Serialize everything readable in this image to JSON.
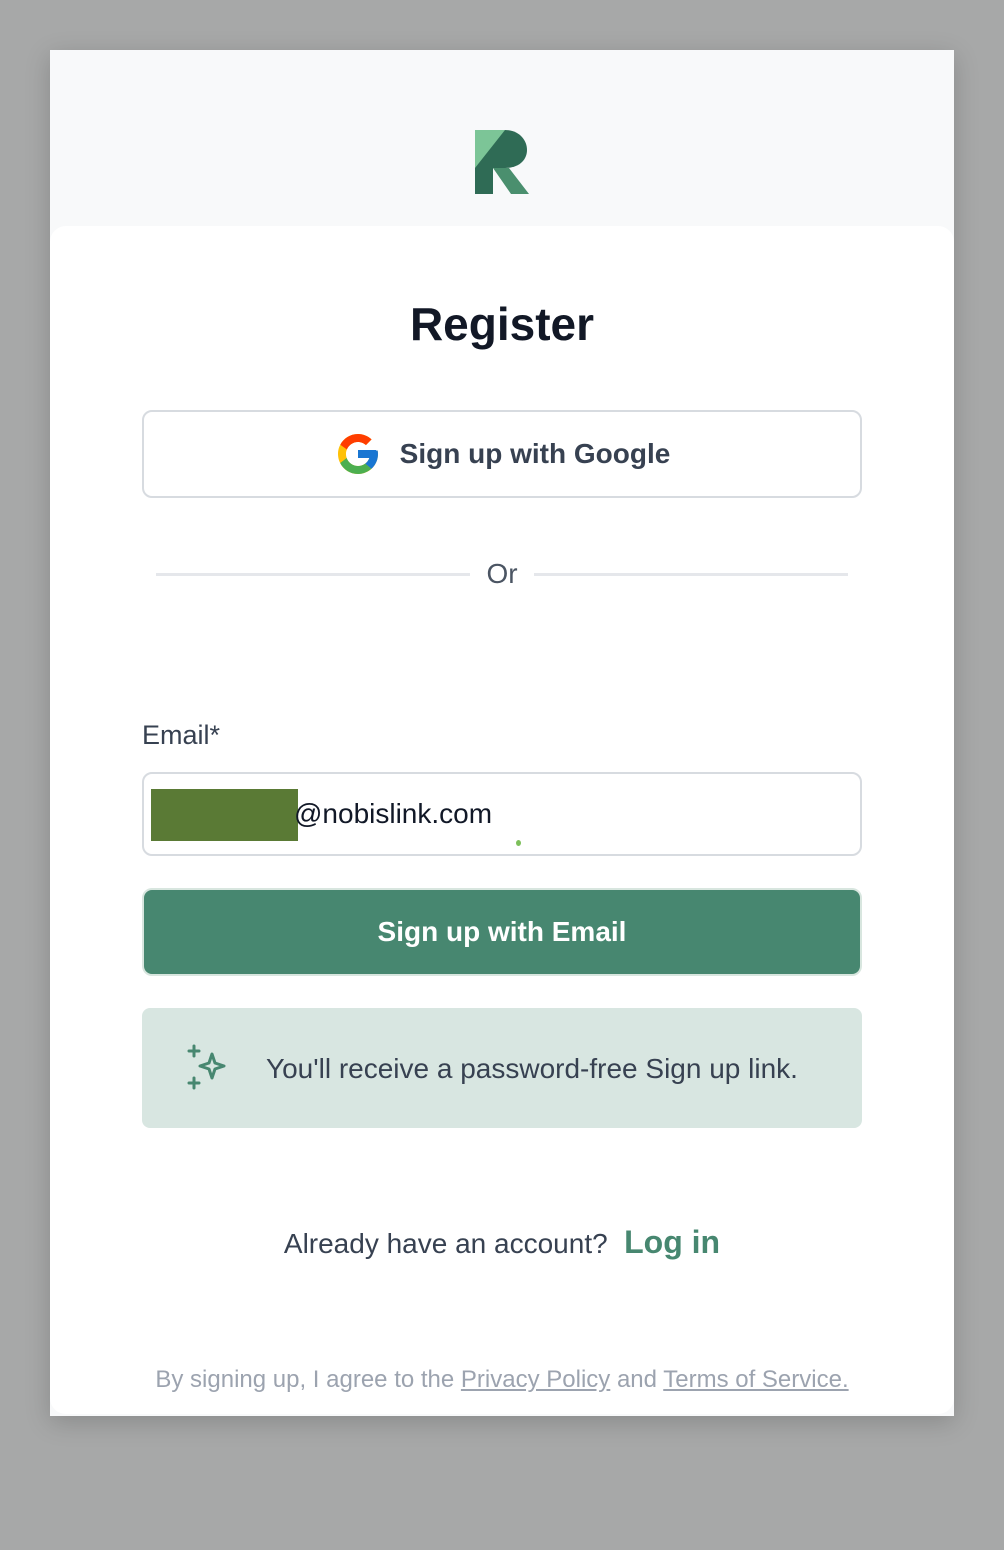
{
  "brand": {
    "logo_icon": "r-logo-icon",
    "colors": {
      "primary": "#478770",
      "logo_light": "#6fb48a",
      "logo_dark": "#2f6b55",
      "info_bg": "#d8e6e1"
    }
  },
  "form": {
    "title": "Register",
    "google_button_label": "Sign up with Google",
    "google_icon": "google-icon",
    "divider_text": "Or",
    "email_label": "Email*",
    "email_value": "@nobislink.com",
    "email_button_label": "Sign up with Email",
    "info_icon": "sparkle-icon",
    "info_text": "You'll receive a password-free Sign up link."
  },
  "login": {
    "question": "Already have an account?",
    "link_label": "Log in"
  },
  "legal": {
    "prefix": "By signing up, I agree to the ",
    "privacy_label": "Privacy Policy",
    "conjunction": " and ",
    "terms_label": "Terms of Service."
  }
}
